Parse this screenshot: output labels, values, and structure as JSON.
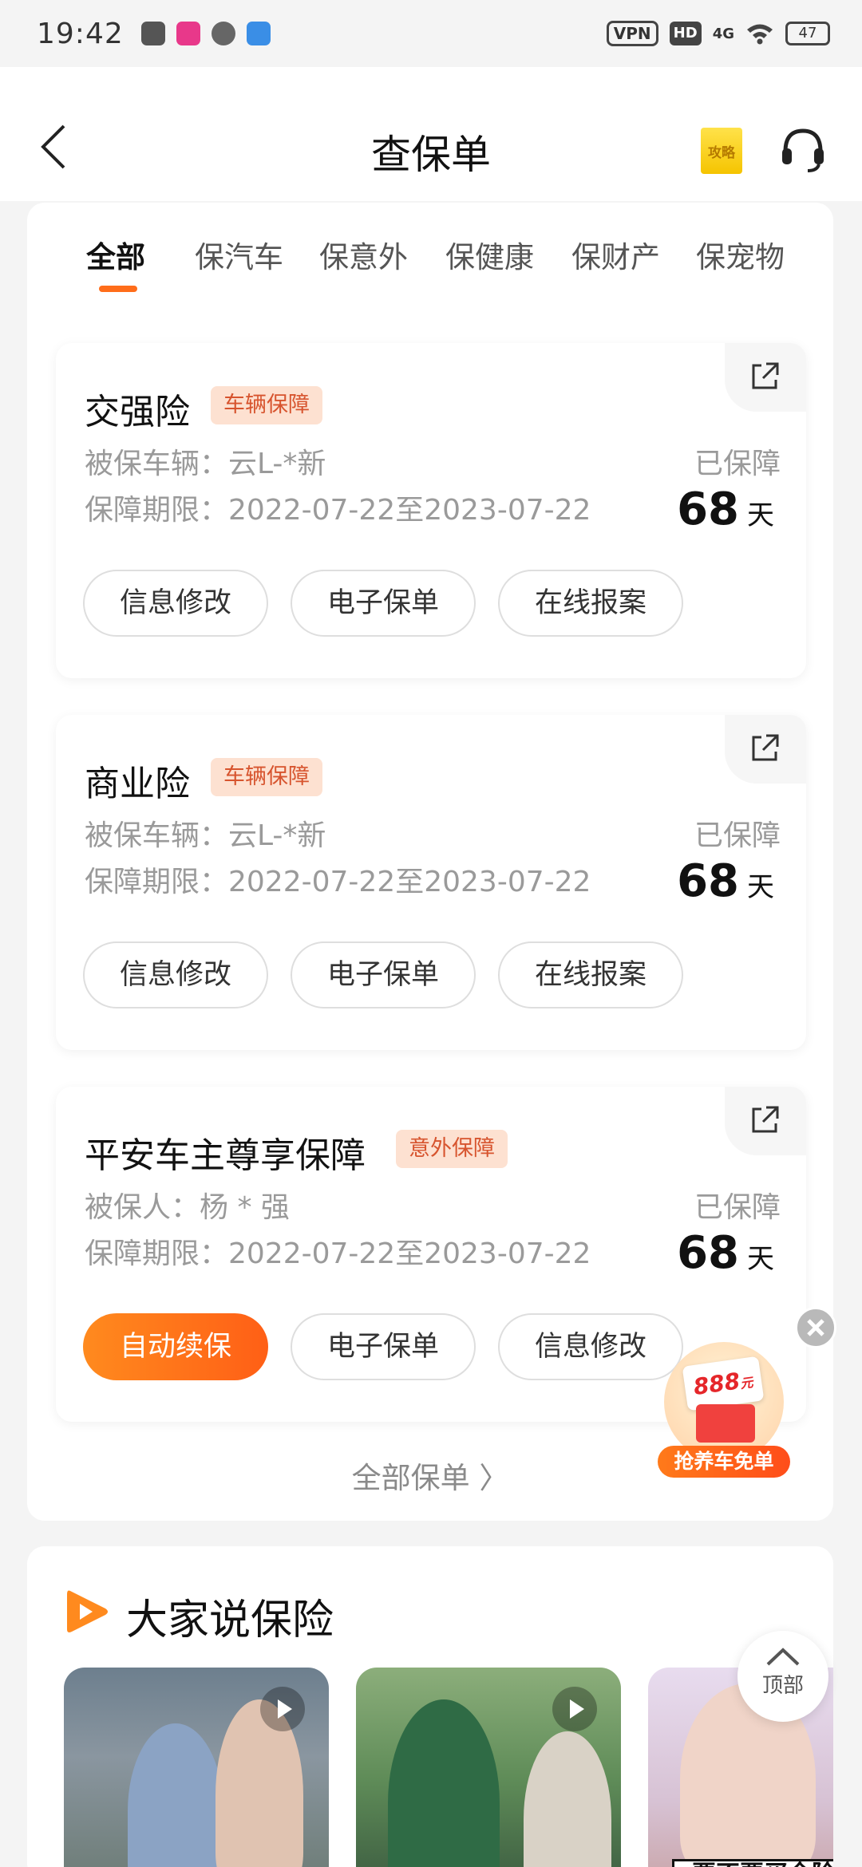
{
  "status_bar": {
    "time": "19:42",
    "vpn": "VPN",
    "hd": "HD",
    "network": "4G",
    "battery": "47"
  },
  "nav": {
    "title": "查保单",
    "guide_label": "攻略"
  },
  "tabs": [
    "全部",
    "保汽车",
    "保意外",
    "保健康",
    "保财产",
    "保宠物"
  ],
  "policies": [
    {
      "name": "交强险",
      "tag": "车辆保障",
      "line1": "被保车辆：云L-*新",
      "line2": "保障期限：2022-07-22至2023-07-22",
      "status": "已保障",
      "days": "68",
      "unit": "天",
      "buttons": [
        "信息修改",
        "电子保单",
        "在线报案"
      ]
    },
    {
      "name": "商业险",
      "tag": "车辆保障",
      "line1": "被保车辆：云L-*新",
      "line2": "保障期限：2022-07-22至2023-07-22",
      "status": "已保障",
      "days": "68",
      "unit": "天",
      "buttons": [
        "信息修改",
        "电子保单",
        "在线报案"
      ]
    },
    {
      "name": "平安车主尊享保障",
      "tag": "意外保障",
      "line1": "被保人：杨 * 强",
      "line2": "保障期限：2022-07-22至2023-07-22",
      "status": "已保障",
      "days": "68",
      "unit": "天",
      "buttons": [
        "自动续保",
        "电子保单",
        "信息修改"
      ]
    }
  ],
  "all_policies": "全部保单 〉",
  "promo": {
    "amount": "888",
    "currency": "元",
    "label": "抢养车免单"
  },
  "section2": {
    "title": "大家说保险",
    "video3_caption": "要不要买全险"
  },
  "top_button": "顶部",
  "colors": {
    "accent": "#ff6d1a",
    "tag_bg": "#fde1d1",
    "tag_text": "#d7542e"
  }
}
